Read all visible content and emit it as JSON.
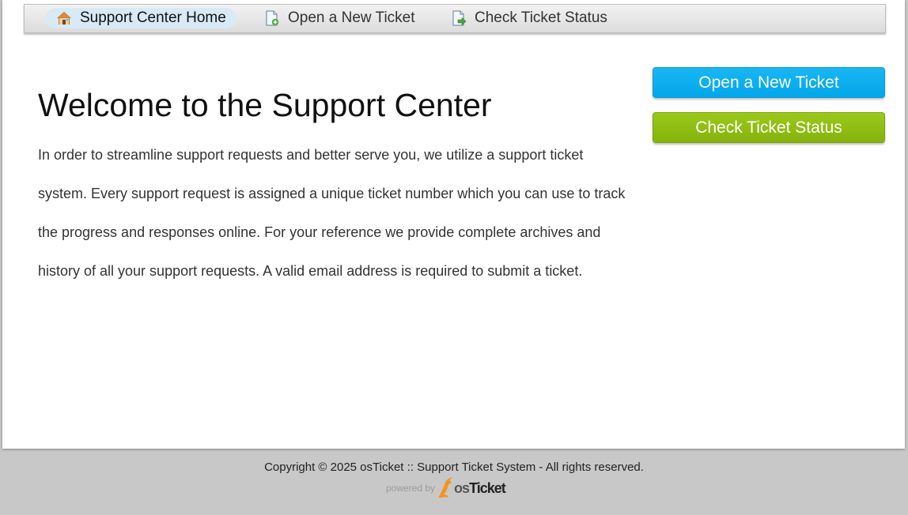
{
  "nav": {
    "items": [
      {
        "label": "Support Center Home",
        "icon": "home-icon",
        "active": true
      },
      {
        "label": "Open a New Ticket",
        "icon": "new-ticket-icon",
        "active": false
      },
      {
        "label": "Check Ticket Status",
        "icon": "ticket-status-icon",
        "active": false
      }
    ]
  },
  "main": {
    "title": "Welcome to the Support Center",
    "intro": "In order to streamline support requests and better serve you, we utilize a support ticket system. Every support request is assigned a unique ticket number which you can use to track the progress and responses online. For your reference we provide complete archives and history of all your support requests. A valid email address is required to submit a ticket."
  },
  "sidebar": {
    "open_ticket_label": "Open a New Ticket",
    "check_status_label": "Check Ticket Status"
  },
  "footer": {
    "copyright": "Copyright © 2025 osTicket :: Support Ticket System - All rights reserved.",
    "powered_by": "powered by",
    "logo_text_os": "os",
    "logo_text_ticket": "Ticket"
  },
  "colors": {
    "open_ticket_button": "#02a7ea",
    "check_status_button": "#84b30c",
    "page_background": "#c8c8c8",
    "active_nav": "#d7eaf6",
    "logo_accent": "#f7931e"
  }
}
